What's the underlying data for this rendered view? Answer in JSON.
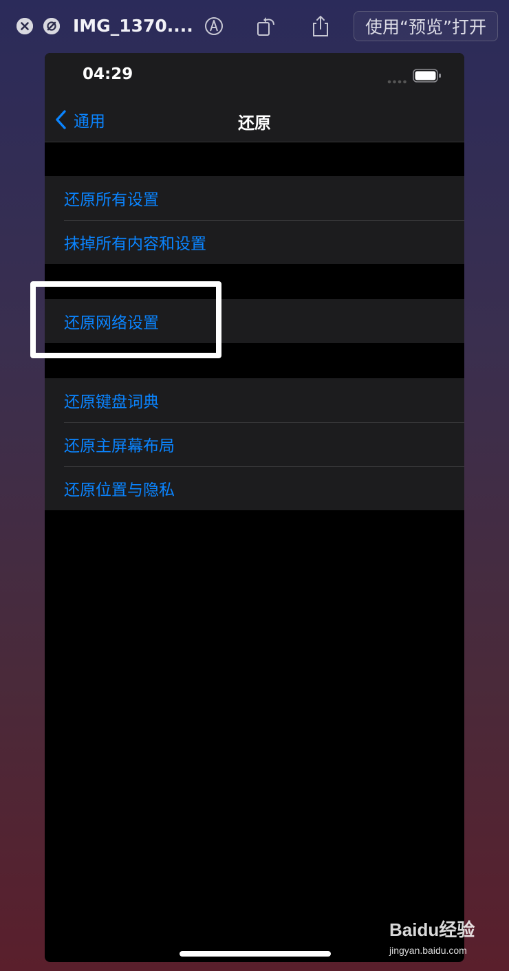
{
  "quicklook": {
    "title": "IMG_1370....",
    "open_with_label": "使用“预览”打开",
    "icons": [
      "close-icon",
      "zoom-icon",
      "markup-icon",
      "rotate-icon",
      "share-icon"
    ]
  },
  "phone": {
    "status_bar": {
      "time": "04:29"
    },
    "nav": {
      "back_label": "通用",
      "title": "还原"
    },
    "groups": [
      {
        "items": [
          {
            "label": "还原所有设置"
          },
          {
            "label": "抹掉所有内容和设置"
          }
        ]
      },
      {
        "items": [
          {
            "label": "还原网络设置"
          }
        ]
      },
      {
        "items": [
          {
            "label": "还原键盘词典"
          },
          {
            "label": "还原主屏幕布局"
          },
          {
            "label": "还原位置与隐私"
          }
        ]
      }
    ],
    "accent_color": "#0a84ff"
  },
  "watermark": {
    "brand": "Baidu经验",
    "url": "jingyan.baidu.com"
  }
}
